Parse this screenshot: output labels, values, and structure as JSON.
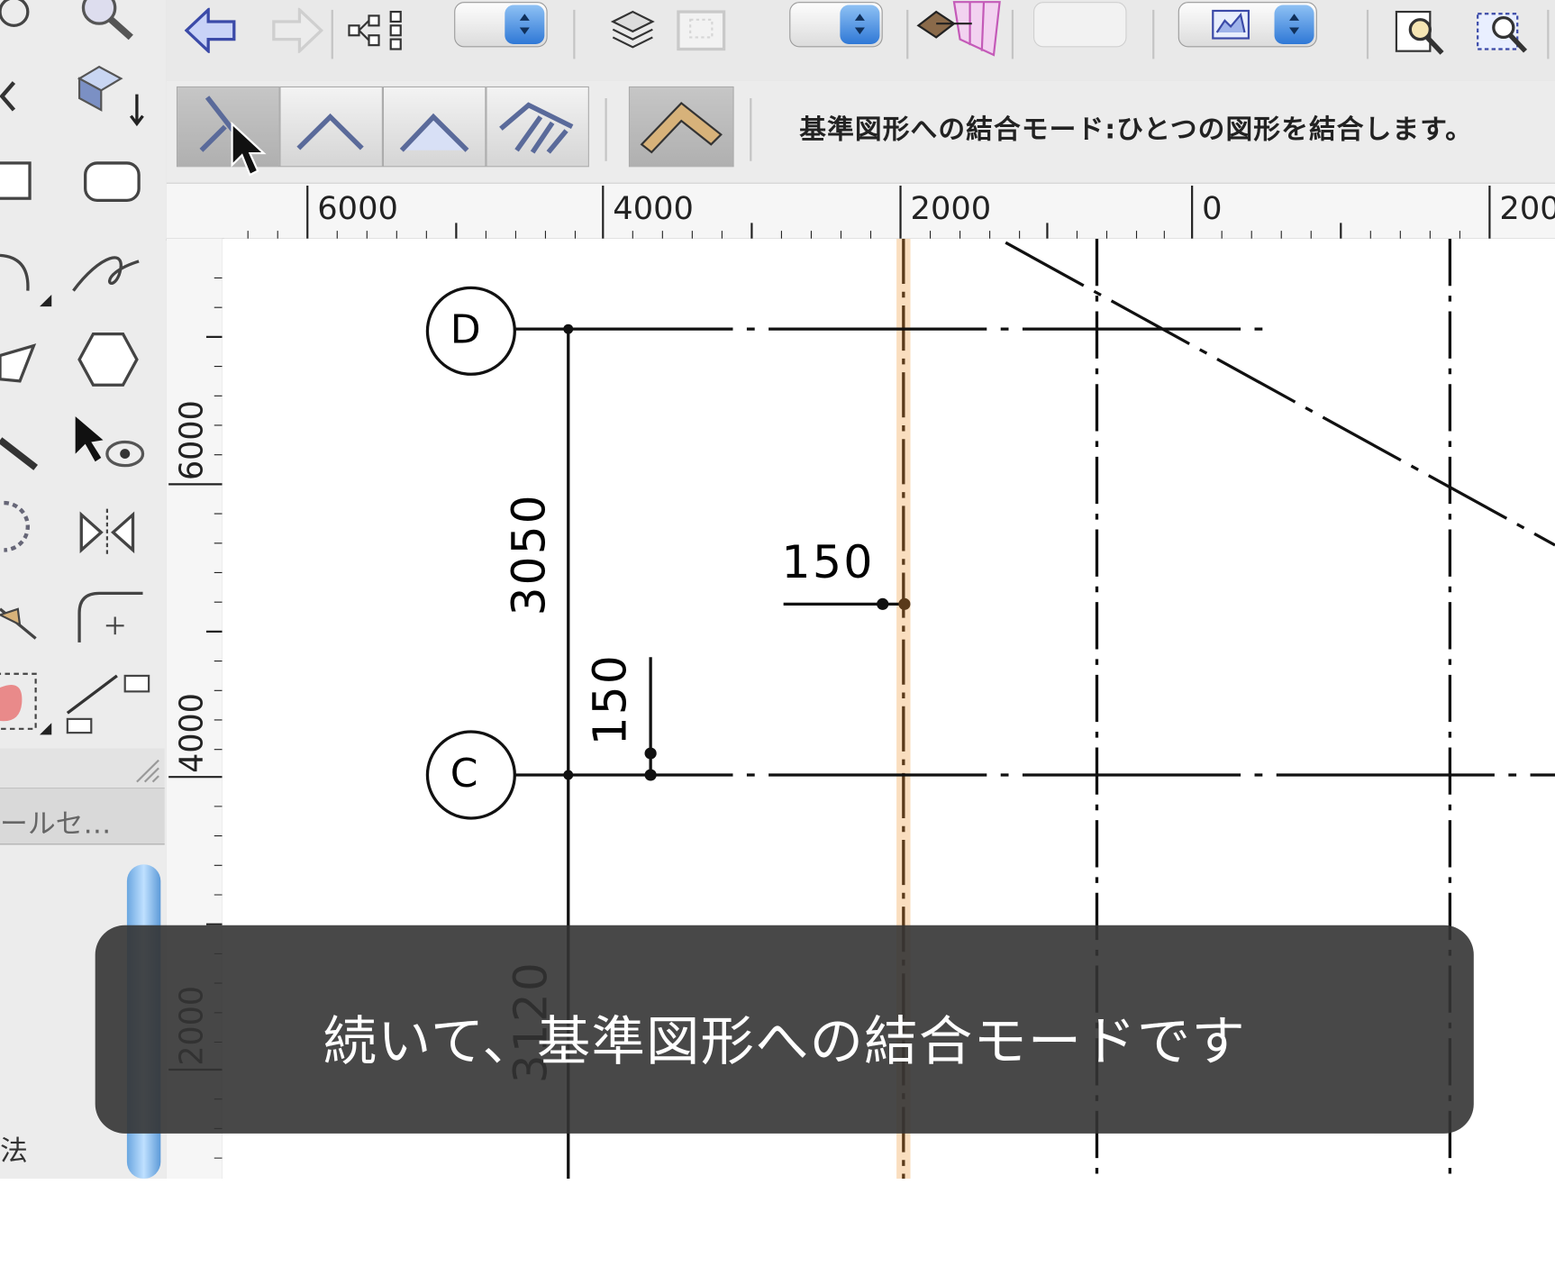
{
  "palette": {
    "footer_label": "ールセ…",
    "corner_char": "法",
    "tools": [
      "eyedropper-tool-icon",
      "zoom-tool-icon",
      "move-left-tool-icon",
      "layer-push-tool-icon",
      "rectangle-tool-icon",
      "rounded-rectangle-tool-icon",
      "arc-tool-icon",
      "freehand-tool-icon",
      "polygon-tool-icon",
      "hexagon-tool-icon",
      "line-tool-icon",
      "visibility-select-tool-icon",
      "rotate-tool-icon",
      "mirror-tool-icon",
      "trim-tool-icon",
      "fillet-tool-icon",
      "eraser-tool-icon",
      "dimension-tool-icon"
    ]
  },
  "toolbar": {
    "buttons": [
      "back-arrow-icon",
      "forward-arrow-icon",
      "hierarchy-icon",
      "layers-icon",
      "sheet-icon",
      "perspective-icon",
      "render-mode-icon",
      "find-replace-icon",
      "zoom-fit-icon"
    ]
  },
  "mode_bar": {
    "hint": "基準図形への結合モード:ひとつの図形を結合します。",
    "modes": [
      "join-to-reference-mode",
      "join-two-mode",
      "join-corner-mode",
      "join-multiple-mode",
      "bevel-corner-mode"
    ],
    "selected_mode": 0
  },
  "rulers": {
    "horizontal": [
      "6000",
      "4000",
      "2000",
      "0",
      "200"
    ],
    "vertical": [
      "6000",
      "4000",
      "2000"
    ]
  },
  "drawing": {
    "grid_d": "D",
    "grid_c": "C",
    "dim_3050": "3050",
    "dim_150_horizontal": "150",
    "dim_150_vertical": "150",
    "dim_3120": "3120"
  },
  "caption": {
    "text": "続いて、基準図形への結合モードです"
  },
  "colors": {
    "highlight_line": "#f5c28a",
    "caption_bg": "#343434",
    "spinner_blue": "#2f78d6"
  }
}
